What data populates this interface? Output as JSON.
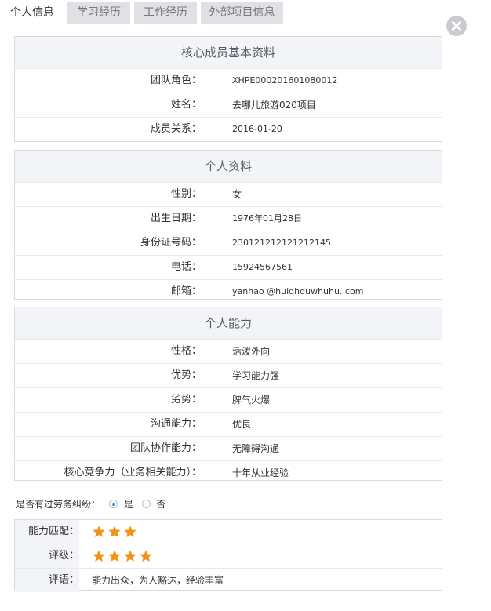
{
  "tabs": [
    "个人信息",
    "学习经历",
    "工作经历",
    "外部项目信息"
  ],
  "core": {
    "title": "核心成员基本资料",
    "rows": [
      {
        "label": "团队角色：",
        "value": "XHPE000201601080012"
      },
      {
        "label": "姓名：",
        "value": "去哪儿旅游020项目"
      },
      {
        "label": "成员关系：",
        "value": "2016-01-20"
      }
    ]
  },
  "personal": {
    "title": "个人资料",
    "rows": [
      {
        "label": "性别：",
        "value": "女"
      },
      {
        "label": "出生日期：",
        "value": "1976年01月28日"
      },
      {
        "label": "身份证号码：",
        "value": "230121212121212145"
      },
      {
        "label": "电话：",
        "value": "15924567561"
      },
      {
        "label": "邮箱：",
        "value": "yanhao @huiqhduwhuhu. com"
      }
    ]
  },
  "ability": {
    "title": "个人能力",
    "rows": [
      {
        "label": "性格：",
        "value": "活泼外向"
      },
      {
        "label": "优势：",
        "value": "学习能力强"
      },
      {
        "label": "劣势：",
        "value": "脾气火爆"
      },
      {
        "label": "沟通能力：",
        "value": "优良"
      },
      {
        "label": "团队协作能力：",
        "value": "无障碍沟通"
      },
      {
        "label": "核心竞争力（业务相关能力）：",
        "value": "十年从业经验"
      }
    ]
  },
  "labor": {
    "question": "是否有过劳务纠纷：",
    "yes": "是",
    "no": "否",
    "selected": "是"
  },
  "evaluation": {
    "match_label": "能力匹配：",
    "match_stars": 3,
    "rating_label": "评级：",
    "rating_stars": 4,
    "comment_label": "评语：",
    "comment": "能力出众，为人豁达，经验丰富"
  },
  "colors": {
    "accent": "#4a8fd6",
    "star": "#f39214",
    "header_bg": "#f2f4f7"
  },
  "icons": {
    "close": "close-icon",
    "star": "star-icon"
  }
}
